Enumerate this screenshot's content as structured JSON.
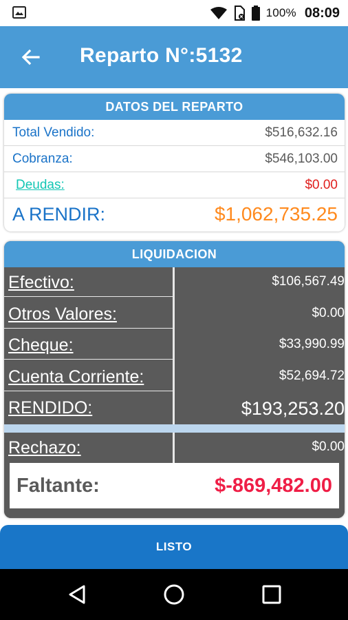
{
  "status_bar": {
    "battery_percent": "100%",
    "time": "08:09",
    "icons": [
      "image-icon",
      "wifi-icon",
      "sim-icon",
      "battery-icon"
    ]
  },
  "app_bar": {
    "title": "Reparto N°:5132",
    "back_icon": "arrow-left-icon"
  },
  "datos": {
    "header": "DATOS DEL REPARTO",
    "total_vendido_label": "Total Vendido:",
    "total_vendido_value": "$516,632.16",
    "cobranza_label": "Cobranza:",
    "cobranza_value": "$546,103.00",
    "deudas_label": "Deudas:",
    "deudas_value": "$0.00",
    "a_rendir_label": "A RENDIR:",
    "a_rendir_value": "$1,062,735.25"
  },
  "liquidacion": {
    "header": "LIQUIDACION",
    "efectivo_label": "Efectivo:",
    "efectivo_value": "$106,567.49",
    "otros_label": "Otros Valores:",
    "otros_value": "$0.00",
    "cheque_label": "Cheque:",
    "cheque_value": "$33,990.99",
    "cuenta_label": "Cuenta Corriente:",
    "cuenta_value": "$52,694.72",
    "rendido_label": "RENDIDO:",
    "rendido_value": "$193,253.20",
    "rechazo_label": "Rechazo:",
    "rechazo_value": "$0.00",
    "faltante_label": "Faltante:",
    "faltante_value": "$-869,482.00"
  },
  "actions": {
    "listo_label": "LISTO"
  },
  "colors": {
    "primary": "#4a9bd6",
    "button": "#1976c8",
    "orange": "#ff8a1e",
    "red": "#e0201e",
    "faltante": "#ef1e46",
    "panel": "#5a5a5a"
  }
}
